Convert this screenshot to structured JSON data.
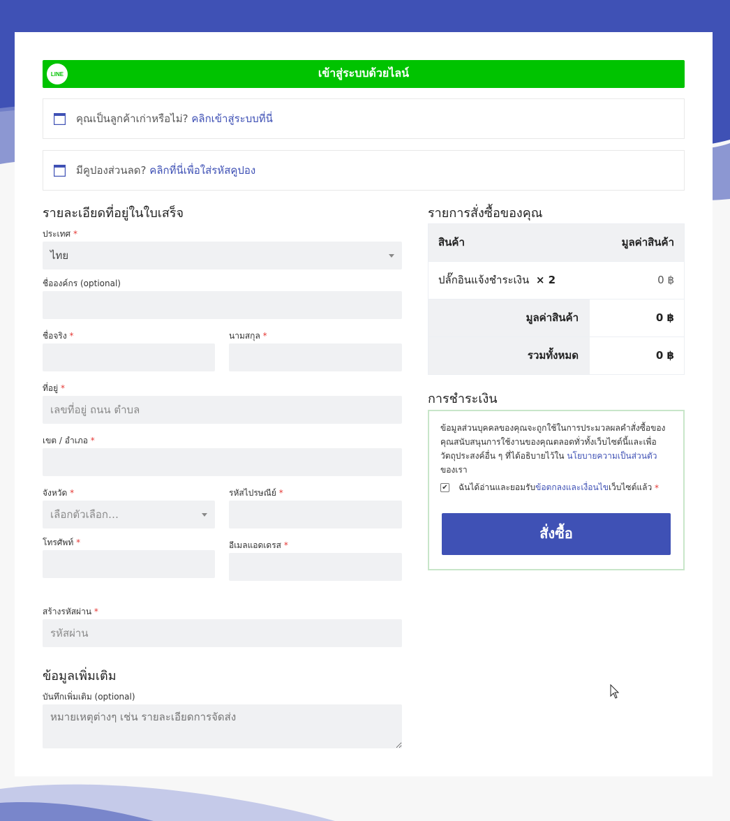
{
  "line_login": {
    "logo_text": "LINE",
    "label": "เข้าสู่ระบบด้วยไลน์"
  },
  "notices": {
    "returning": {
      "text": "คุณเป็นลูกค้าเก่าหรือไม่?",
      "link": "คลิกเข้าสู่ระบบที่นี่"
    },
    "coupon": {
      "text": "มีคูปองส่วนลด?",
      "link": "คลิกที่นี่เพื่อใส่รหัสคูปอง"
    }
  },
  "billing": {
    "heading": "รายละเอียดที่อยู่ในใบเสร็จ",
    "required_mark": "*",
    "country": {
      "label": "ประเทศ",
      "value": "ไทย"
    },
    "company": {
      "label": "ชื่อองค์กร (optional)",
      "value": ""
    },
    "first_name": {
      "label": "ชื่อจริง",
      "value": ""
    },
    "last_name": {
      "label": "นามสกุล",
      "value": ""
    },
    "address": {
      "label": "ที่อยู่",
      "placeholder": "เลขที่อยู่  ถนน ตำบล"
    },
    "district": {
      "label": "เขต / อำเภอ",
      "value": ""
    },
    "province": {
      "label": "จังหวัด",
      "placeholder": "เลือกตัวเลือก…"
    },
    "postcode": {
      "label": "รหัสไปรษณีย์",
      "value": ""
    },
    "phone": {
      "label": "โทรศัพท์",
      "value": ""
    },
    "email": {
      "label": "อีเมลแอดเดรส",
      "value": ""
    },
    "password": {
      "label": "สร้างรหัสผ่าน",
      "placeholder": "รหัสผ่าน"
    }
  },
  "additional": {
    "heading": "ข้อมูลเพิ่มเติม",
    "notes": {
      "label": "บันทึกเพิ่มเติม (optional)",
      "placeholder": "หมายเหตุต่างๆ เช่น รายละเอียดการจัดส่ง"
    }
  },
  "order": {
    "heading": "รายการสั่งซื้อของคุณ",
    "col_product": "สินค้า",
    "col_total": "มูลค่าสินค้า",
    "item": {
      "name": "ปลั๊กอินแจ้งชำระเงิน",
      "qty": "× 2",
      "price": "0 ฿"
    },
    "subtotal": {
      "label": "มูลค่าสินค้า",
      "value": "0 ฿"
    },
    "total": {
      "label": "รวมทั้งหมด",
      "value": "0 ฿"
    }
  },
  "payment": {
    "heading": "การชำระเงิน",
    "policy_text": "ข้อมูลส่วนบุคคลของคุณจะถูกใช้ในการประมวลผลคำสั่งซื้อของคุณสนับสนุนการใช้งานของคุณตลอดทั่วทั้งเว็บไซต์นี้และเพื่อวัตถุประสงค์อื่น ๆ ที่ได้อธิบายไว้ใน",
    "policy_link": "นโยบายความเป็นส่วนตัว",
    "policy_suffix": "ของเรา",
    "agree_prefix": "ฉันได้อ่านและยอมรับ",
    "agree_link": "ข้อตกลงและเงื่อนไข",
    "agree_suffix": "เว็บไซต์แล้ว",
    "agree_checked": true,
    "button": "สั่งซื้อ"
  },
  "colors": {
    "primary": "#3f51b5",
    "line_green": "#00c300",
    "required": "#e53935"
  }
}
